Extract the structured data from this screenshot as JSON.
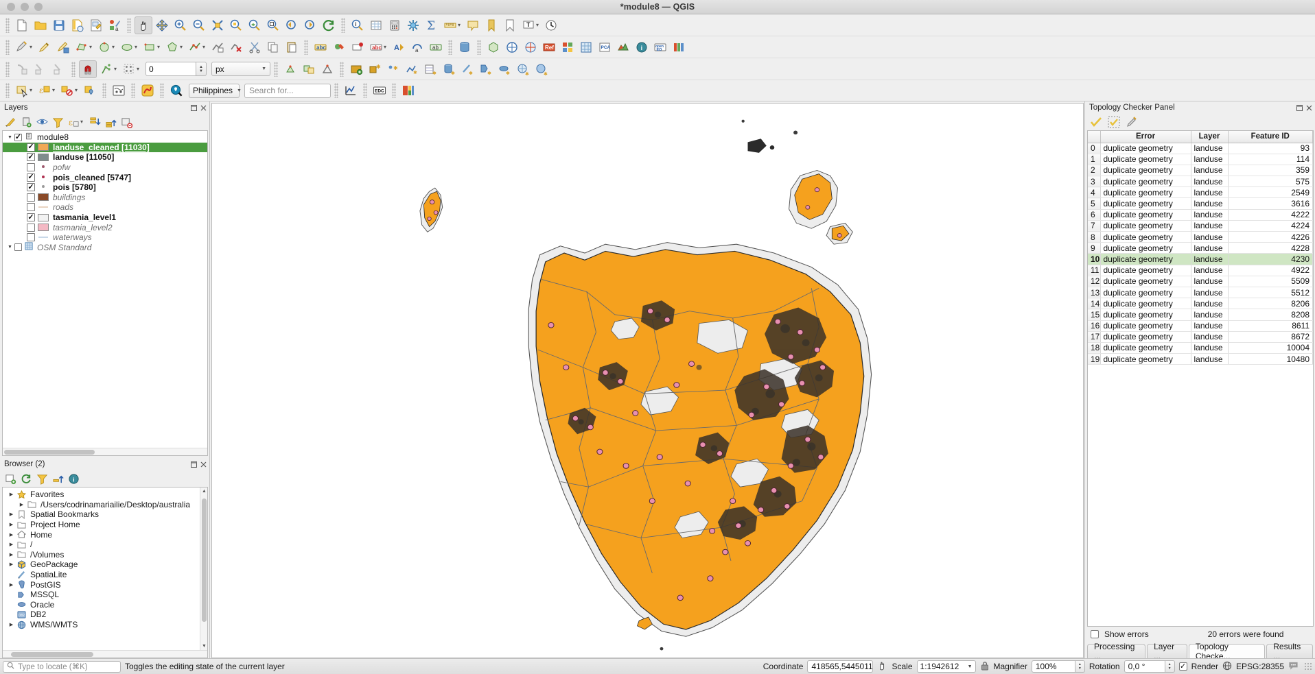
{
  "window": {
    "title": "*module8 — QGIS"
  },
  "snapping": {
    "tolerance_value": "0",
    "units": "px"
  },
  "plugins_toolbar": {
    "country_selector": "Philippines",
    "search_placeholder": "Search for...",
    "edc_label": "EDC"
  },
  "layers_panel": {
    "title": "Layers",
    "toolbar_icons": [
      "style-manager-icon",
      "add-group-icon",
      "visibility-eye-icon",
      "filter-legend-icon",
      "expression-filter-icon",
      "expand-all-icon",
      "collapse-all-icon",
      "remove-layer-icon"
    ],
    "items": [
      {
        "label": "module8",
        "type": "group",
        "checked": true,
        "expanded": true,
        "indent": 0,
        "selected": false,
        "style": "normal",
        "symbol": "group"
      },
      {
        "label": "landuse_cleaned [11030]",
        "type": "polygon",
        "checked": true,
        "indent": 1,
        "selected": true,
        "style": "bold",
        "symbol": "swatch",
        "color": "#f0a955"
      },
      {
        "label": "landuse [11050]",
        "type": "polygon",
        "checked": true,
        "indent": 1,
        "selected": false,
        "style": "bold",
        "symbol": "swatch",
        "color": "#7f8c8d"
      },
      {
        "label": "pofw",
        "type": "point",
        "checked": false,
        "indent": 1,
        "selected": false,
        "style": "italic",
        "symbol": "dot",
        "color": "#9e5a6e"
      },
      {
        "label": "pois_cleaned [5747]",
        "type": "point",
        "checked": true,
        "indent": 1,
        "selected": false,
        "style": "bold",
        "symbol": "dot",
        "color": "#b03050"
      },
      {
        "label": "pois [5780]",
        "type": "point",
        "checked": true,
        "indent": 1,
        "selected": false,
        "style": "bold",
        "symbol": "dot",
        "color": "#9b9b9b"
      },
      {
        "label": "buildings",
        "type": "polygon",
        "checked": false,
        "indent": 1,
        "selected": false,
        "style": "italic",
        "symbol": "swatch",
        "color": "#8a4a28"
      },
      {
        "label": "roads",
        "type": "line",
        "checked": false,
        "indent": 1,
        "selected": false,
        "style": "italic",
        "symbol": "line",
        "color": "#e8d3c0"
      },
      {
        "label": "tasmania_level1",
        "type": "polygon",
        "checked": true,
        "indent": 1,
        "selected": false,
        "style": "bold",
        "symbol": "swatch",
        "color": "#f2f2f2"
      },
      {
        "label": "tasmania_level2",
        "type": "polygon",
        "checked": false,
        "indent": 1,
        "selected": false,
        "style": "italic",
        "symbol": "swatch",
        "color": "#f4b9c4"
      },
      {
        "label": "waterways",
        "type": "line",
        "checked": false,
        "indent": 1,
        "selected": false,
        "style": "italic",
        "symbol": "line",
        "color": "#c8d8e8"
      },
      {
        "label": "OSM Standard",
        "type": "raster",
        "checked": false,
        "indent": 0,
        "selected": false,
        "style": "italic",
        "symbol": "raster"
      }
    ]
  },
  "browser_panel": {
    "title": "Browser (2)",
    "items": [
      {
        "label": "Favorites",
        "icon": "star-icon",
        "expandable": true,
        "indent": 0
      },
      {
        "label": "/Users/codrinamariailie/Desktop/australia",
        "icon": "folder-icon",
        "expandable": true,
        "indent": 1
      },
      {
        "label": "Spatial Bookmarks",
        "icon": "bookmark-icon",
        "expandable": true,
        "indent": 0
      },
      {
        "label": "Project Home",
        "icon": "folder-icon",
        "expandable": true,
        "indent": 0
      },
      {
        "label": "Home",
        "icon": "home-icon",
        "expandable": true,
        "indent": 0
      },
      {
        "label": "/",
        "icon": "folder-icon",
        "expandable": true,
        "indent": 0
      },
      {
        "label": "/Volumes",
        "icon": "folder-icon",
        "expandable": true,
        "indent": 0
      },
      {
        "label": "GeoPackage",
        "icon": "geopackage-icon",
        "expandable": true,
        "indent": 0
      },
      {
        "label": "SpatiaLite",
        "icon": "spatialite-icon",
        "expandable": false,
        "indent": 0
      },
      {
        "label": "PostGIS",
        "icon": "postgis-icon",
        "expandable": true,
        "indent": 0
      },
      {
        "label": "MSSQL",
        "icon": "mssql-icon",
        "expandable": false,
        "indent": 0
      },
      {
        "label": "Oracle",
        "icon": "oracle-icon",
        "expandable": false,
        "indent": 0
      },
      {
        "label": "DB2",
        "icon": "db2-icon",
        "expandable": false,
        "indent": 0
      },
      {
        "label": "WMS/WMTS",
        "icon": "wms-icon",
        "expandable": true,
        "indent": 0
      }
    ]
  },
  "topology_panel": {
    "title": "Topology Checker Panel",
    "toolbar_icons": [
      "validate-all-icon",
      "validate-extent-icon",
      "configure-icon"
    ],
    "columns": [
      "Error",
      "Layer",
      "Feature ID"
    ],
    "rows": [
      {
        "idx": "0",
        "error": "duplicate geometry",
        "layer": "landuse",
        "fid": "93",
        "highlight": false
      },
      {
        "idx": "1",
        "error": "duplicate geometry",
        "layer": "landuse",
        "fid": "114",
        "highlight": false
      },
      {
        "idx": "2",
        "error": "duplicate geometry",
        "layer": "landuse",
        "fid": "359",
        "highlight": false
      },
      {
        "idx": "3",
        "error": "duplicate geometry",
        "layer": "landuse",
        "fid": "575",
        "highlight": false
      },
      {
        "idx": "4",
        "error": "duplicate geometry",
        "layer": "landuse",
        "fid": "2549",
        "highlight": false
      },
      {
        "idx": "5",
        "error": "duplicate geometry",
        "layer": "landuse",
        "fid": "3616",
        "highlight": false
      },
      {
        "idx": "6",
        "error": "duplicate geometry",
        "layer": "landuse",
        "fid": "4222",
        "highlight": false
      },
      {
        "idx": "7",
        "error": "duplicate geometry",
        "layer": "landuse",
        "fid": "4224",
        "highlight": false
      },
      {
        "idx": "8",
        "error": "duplicate geometry",
        "layer": "landuse",
        "fid": "4226",
        "highlight": false
      },
      {
        "idx": "9",
        "error": "duplicate geometry",
        "layer": "landuse",
        "fid": "4228",
        "highlight": false
      },
      {
        "idx": "10",
        "error": "duplicate geometry",
        "layer": "landuse",
        "fid": "4230",
        "highlight": true
      },
      {
        "idx": "11",
        "error": "duplicate geometry",
        "layer": "landuse",
        "fid": "4922",
        "highlight": false
      },
      {
        "idx": "12",
        "error": "duplicate geometry",
        "layer": "landuse",
        "fid": "5509",
        "highlight": false
      },
      {
        "idx": "13",
        "error": "duplicate geometry",
        "layer": "landuse",
        "fid": "5512",
        "highlight": false
      },
      {
        "idx": "14",
        "error": "duplicate geometry",
        "layer": "landuse",
        "fid": "8206",
        "highlight": false
      },
      {
        "idx": "15",
        "error": "duplicate geometry",
        "layer": "landuse",
        "fid": "8208",
        "highlight": false
      },
      {
        "idx": "16",
        "error": "duplicate geometry",
        "layer": "landuse",
        "fid": "8611",
        "highlight": false
      },
      {
        "idx": "17",
        "error": "duplicate geometry",
        "layer": "landuse",
        "fid": "8672",
        "highlight": false
      },
      {
        "idx": "18",
        "error": "duplicate geometry",
        "layer": "landuse",
        "fid": "10004",
        "highlight": false
      },
      {
        "idx": "19",
        "error": "duplicate geometry",
        "layer": "landuse",
        "fid": "10480",
        "highlight": false
      }
    ],
    "show_errors_label": "Show errors",
    "show_errors_checked": false,
    "error_count_text": "20 errors were found"
  },
  "bottom_tabs": [
    {
      "label": "Processing ...",
      "active": false
    },
    {
      "label": "Layer ...",
      "active": false
    },
    {
      "label": "Topology Checke...",
      "active": true
    },
    {
      "label": "Results ...",
      "active": false
    }
  ],
  "status_bar": {
    "locate_placeholder": "Type to locate (⌘K)",
    "message": "Toggles the editing state of the current layer",
    "coordinate_label": "Coordinate",
    "coordinate_value": "418565,5445011",
    "scale_label": "Scale",
    "scale_value": "1:1942612",
    "magnifier_label": "Magnifier",
    "magnifier_value": "100%",
    "rotation_label": "Rotation",
    "rotation_value": "0,0 °",
    "render_label": "Render",
    "render_checked": true,
    "crs": "EPSG:28355"
  },
  "colors": {
    "landuse_fill": "#F5A11E",
    "landuse_stroke": "#2b2b2b",
    "poi_fill": "#e890b0",
    "poi_stroke": "#4a2030",
    "selection_green": "#4a9c3f",
    "row_highlight": "#cfe6c3",
    "tasmania_fill": "#ededed"
  }
}
